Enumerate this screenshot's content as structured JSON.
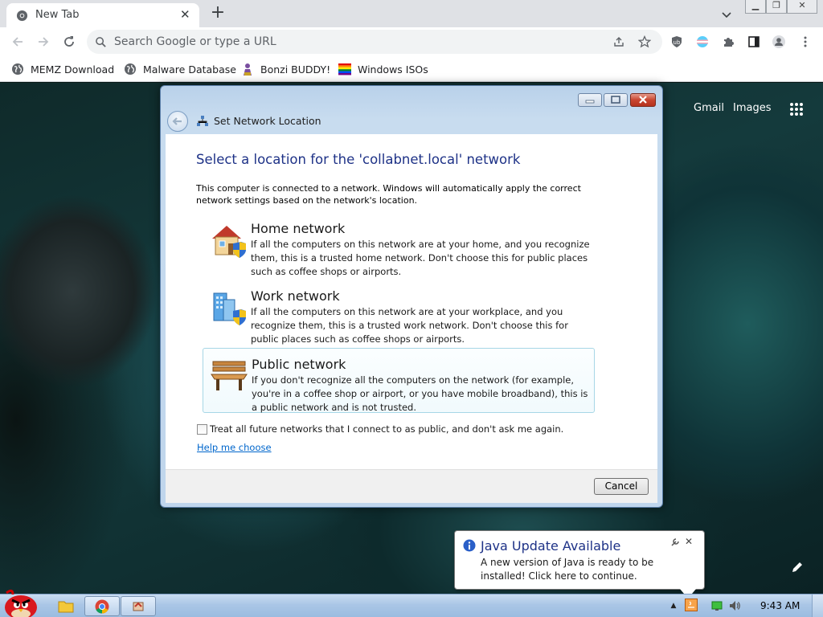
{
  "browser": {
    "tab": {
      "title": "New Tab",
      "close": "✕"
    },
    "new_tab": "+",
    "window_controls": {
      "minimize": "▁",
      "restore": "❐",
      "close": "✕"
    },
    "omnibox": {
      "placeholder": "Search Google or type a URL"
    },
    "bookmarks": [
      {
        "label": "MEMZ Download",
        "icon": "globe-icon"
      },
      {
        "label": "Malware Database",
        "icon": "globe-icon"
      },
      {
        "label": "Bonzi BUDDY!",
        "icon": "bonzi-icon"
      },
      {
        "label": "Windows ISOs",
        "icon": "windows-flag-icon"
      }
    ]
  },
  "newtab_page": {
    "links": [
      "Gmail",
      "Images"
    ]
  },
  "dialog": {
    "title": "Set Network Location",
    "heading": "Select a location for the 'collabnet.local' network",
    "description": "This computer is connected to a network. Windows will automatically apply the correct network settings based on the network's location.",
    "options": [
      {
        "title": "Home network",
        "desc": "If all the computers on this network are at your home, and you recognize them, this is a trusted home network.  Don't choose this for public places such as coffee shops or airports.",
        "icon": "home-network-icon"
      },
      {
        "title": "Work network",
        "desc": "If all the computers on this network are at your workplace, and you recognize them, this is a trusted work network.  Don't choose this for public places such as coffee shops or airports.",
        "icon": "work-network-icon"
      },
      {
        "title": "Public network",
        "desc": "If you don't recognize all the computers on the network (for example, you're in a coffee shop or airport, or you have mobile broadband), this is a public network and is not trusted.",
        "icon": "public-network-icon"
      }
    ],
    "checkbox_label": "Treat all future networks that I connect to as public, and don't ask me again.",
    "help_link": "Help me choose",
    "cancel_label": "Cancel"
  },
  "notification": {
    "title": "Java Update Available",
    "text": "A new version of Java is ready to be installed! Click here to continue.",
    "close": "✕"
  },
  "taskbar": {
    "clock": "9:43 AM",
    "tray_arrow": "▲"
  },
  "colors": {
    "dialog_heading": "#1e3287",
    "link": "#0066cc",
    "taskbar": "#aac6e6"
  }
}
